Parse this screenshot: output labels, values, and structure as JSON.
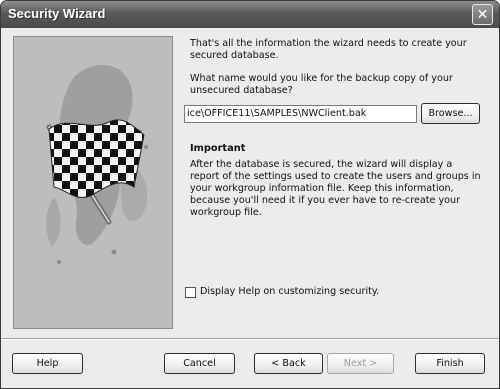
{
  "window": {
    "title": "Security Wizard",
    "close_glyph": "✕"
  },
  "content": {
    "intro": "That's all the information the wizard needs to create your secured database.",
    "backup_question": "What name would you like for the backup copy of your unsecured database?",
    "backup_path": "ice\\OFFICE11\\SAMPLES\\NWClient.bak",
    "browse_label": "Browse...",
    "important_heading": "Important",
    "important_body": "After the database is secured, the wizard will display a report of the settings used to create the users and groups in your workgroup information file. Keep this information, because you'll need it if you ever have to re-create your workgroup file.",
    "help_checkbox_label": "Display Help on customizing security.",
    "help_checkbox_checked": false
  },
  "image": {
    "icon": "checkered-flag-icon"
  },
  "buttons": {
    "help": "Help",
    "cancel": "Cancel",
    "back": "< Back",
    "next": "Next >",
    "finish": "Finish"
  },
  "colors": {
    "titlebar": "#5a5a5a",
    "dialog_bg": "#ececec",
    "image_panel_bg": "#bdbdbd"
  }
}
